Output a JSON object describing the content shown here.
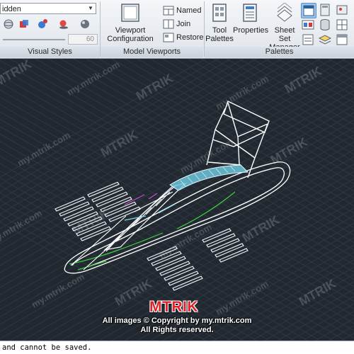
{
  "ribbon": {
    "visual_styles": {
      "style_select_value": "idden",
      "opacity_value": "60",
      "panel_label": "Visual Styles"
    },
    "model_viewports": {
      "viewport_configuration_label_1": "Viewport",
      "viewport_configuration_label_2": "Configuration",
      "named_label": "Named",
      "join_label": "Join",
      "restore_label": "Restore",
      "panel_label": "Model Viewports"
    },
    "palettes": {
      "tool_palettes_label_1": "Tool",
      "tool_palettes_label_2": "Palettes",
      "properties_label": "Properties",
      "sheet_set_label_1": "Sheet Set",
      "sheet_set_label_2": "Manager",
      "panel_label": "Palettes"
    }
  },
  "drawing": {
    "background_color": "#212830",
    "line_color": "#ffffff",
    "accent_colors": {
      "canopy": "#7fd7e8",
      "green_edge": "#3fd13f",
      "magenta_edge": "#d24bd2"
    },
    "overlay": {
      "brand": "MTRIK",
      "copyright": "All images © Copyright by my.mtrik.com",
      "rights": "All Rights reserved."
    }
  },
  "command_line": {
    "text": "and cannot be saved."
  }
}
